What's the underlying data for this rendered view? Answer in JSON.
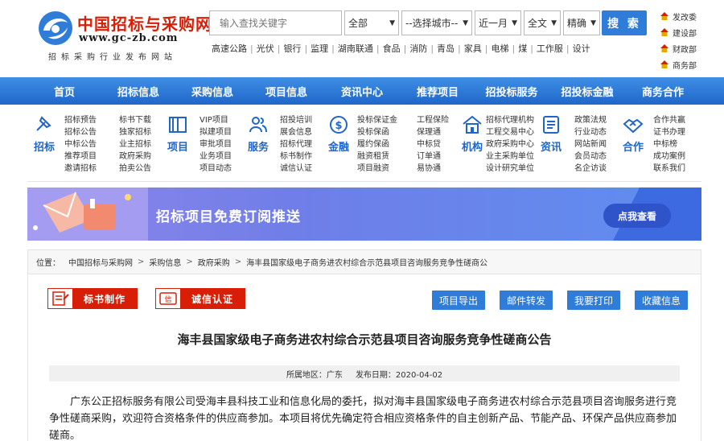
{
  "header": {
    "logo_title": "中国招标与采购网",
    "logo_url": "www.gc-zb.com",
    "logo_slogan": "招标采购行业发布网站",
    "search_placeholder": "输入查找关键字",
    "filter_type": "全部",
    "filter_city": "--选择城市--",
    "filter_time": "近一月",
    "filter_scope": "全文",
    "filter_match": "精确",
    "search_button": "搜 索",
    "hot_words": [
      "高速公路",
      "光伏",
      "银行",
      "监理",
      "湖南联通",
      "食品",
      "消防",
      "青岛",
      "家具",
      "电梯",
      "煤",
      "工作服",
      "设计"
    ],
    "side_links": [
      "发改委",
      "建设部",
      "财政部",
      "商务部"
    ]
  },
  "nav": [
    "首页",
    "招标信息",
    "采购信息",
    "项目信息",
    "资讯中心",
    "推荐项目",
    "招投标服务",
    "招投标金融",
    "商务合作"
  ],
  "categories": [
    {
      "name": "招标",
      "icon": "pin-icon",
      "cols": [
        [
          "招标预告",
          "招标公告",
          "中标公告",
          "推荐项目",
          "邀请招标"
        ],
        [
          "标书下载",
          "独家招标",
          "业主招标",
          "政府采购",
          "拍卖公告"
        ]
      ]
    },
    {
      "name": "项目",
      "icon": "book-icon",
      "cols": [
        [
          "VIP项目",
          "拟建项目",
          "审批项目",
          "业务项目",
          "项目动态"
        ]
      ]
    },
    {
      "name": "服务",
      "icon": "users-icon",
      "cols": [
        [
          "招投培训",
          "展会信息",
          "招标代理",
          "标书制作",
          "诚信认证"
        ]
      ]
    },
    {
      "name": "金融",
      "icon": "dollar-icon",
      "cols": [
        [
          "投标保证金",
          "投标保函",
          "履约保函",
          "融资租赁",
          "项目融资"
        ]
      ]
    },
    {
      "name": "",
      "icon": "",
      "cols": [
        [
          "工程保险",
          "保理通",
          "中标贷",
          "订单通",
          "易协通"
        ]
      ]
    },
    {
      "name": "机构",
      "icon": "home-icon",
      "cols": [
        [
          "招标代理机构",
          "工程交易中心",
          "政府采购中心",
          "业主采购单位",
          "设计研究单位"
        ]
      ]
    },
    {
      "name": "资讯",
      "icon": "doc-icon",
      "cols": [
        [
          "政策法规",
          "行业动态",
          "网站新闻",
          "会员动态",
          "名企访谈"
        ]
      ]
    },
    {
      "name": "合作",
      "icon": "handshake-icon",
      "cols": [
        [
          "合作共赢",
          "证书办理",
          "中标榜",
          "成功案例",
          "联系我们"
        ]
      ]
    }
  ],
  "banner": {
    "text": "招标项目免费订阅推送",
    "button": "点我查看"
  },
  "breadcrumb": {
    "label": "位置：",
    "items": [
      "中国招标与采购网",
      "采购信息",
      "政府采购",
      "海丰县国家级电子商务进农村综合示范县项目咨询服务竞争性磋商公"
    ]
  },
  "actions": {
    "red": [
      "标书制作",
      "诚信认证"
    ],
    "blue": [
      "项目导出",
      "邮件转发",
      "我要打印",
      "收藏信息"
    ]
  },
  "article": {
    "title": "海丰县国家级电子商务进农村综合示范县项目咨询服务竞争性磋商公告",
    "region_label": "所属地区：广东",
    "date_label": "发布日期：2020-04-02",
    "body": "广东公正招标服务有限公司受海丰县科技工业和信息化局的委托，拟对海丰县国家级电子商务进农村综合示范县项目咨询服务进行竞争性磋商采购，欢迎符合资格条件的供应商参加。本项目将优先确定符合相应资格条件的自主创新产品、节能产品、环保产品供应商参加磋商。"
  },
  "colors": {
    "brand_blue": "#1f66c8",
    "brand_red": "#d81e06",
    "button_blue": "#2f7cd9"
  }
}
